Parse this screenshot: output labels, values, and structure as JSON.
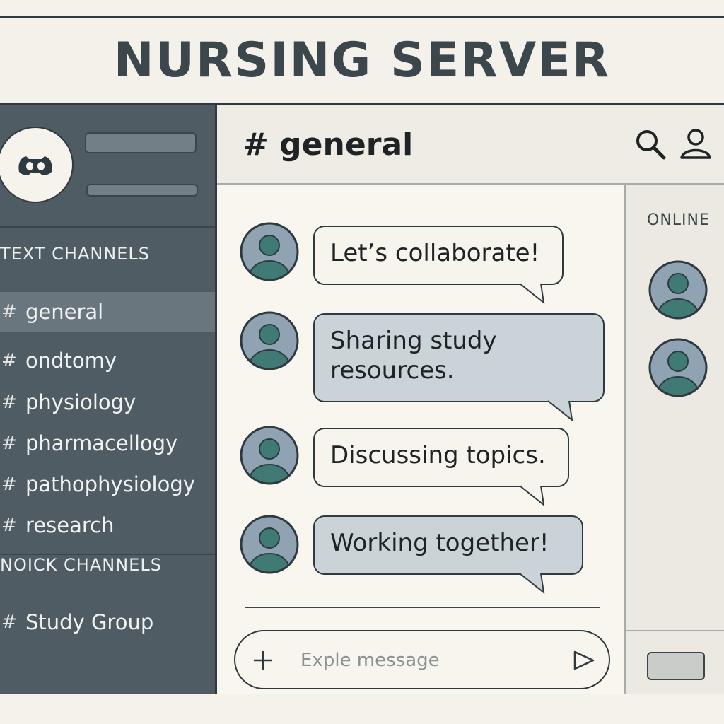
{
  "app": {
    "title": "NURSING SERVER"
  },
  "sidebar": {
    "text_section_label": "TEXT CHANNELS",
    "channels": [
      {
        "icon": "#",
        "label": "general",
        "active": true
      },
      {
        "icon": "#",
        "label": "ondtomy",
        "active": false
      },
      {
        "icon": "#",
        "label": "physiology",
        "active": false
      },
      {
        "icon": "#",
        "label": "pharmacellogy",
        "active": false
      },
      {
        "icon": "#",
        "label": "pathophysiology",
        "active": false
      },
      {
        "icon": "#",
        "label": "research",
        "active": false
      }
    ],
    "voice_section_label": "NOICK CHANNELS",
    "voice_channels": [
      {
        "icon": "#",
        "label": "Study Group"
      }
    ]
  },
  "chat": {
    "channel_title": "# general",
    "messages": [
      {
        "text": "Let’s collaborate!",
        "style": "light"
      },
      {
        "text": "Sharing study resources.",
        "style": "blue"
      },
      {
        "text": "Discussing topics.",
        "style": "light"
      },
      {
        "text": "Working together!",
        "style": "blue"
      }
    ],
    "composer": {
      "placeholder": "Exple message"
    }
  },
  "online": {
    "label": "ONLINE",
    "member_count": 2
  },
  "colors": {
    "sidebar_bg": "#505c64",
    "active_channel_bg": "#6a767e",
    "bubble_blue": "#c9d3d8",
    "avatar_fill": "#8fa3b3",
    "avatar_figure": "#3f7a74",
    "outline": "#2f3a40"
  },
  "icons": {
    "server_logo": "discord-logo-icon",
    "search": "search-icon",
    "user": "user-icon",
    "add": "plus-icon",
    "send": "send-icon"
  }
}
